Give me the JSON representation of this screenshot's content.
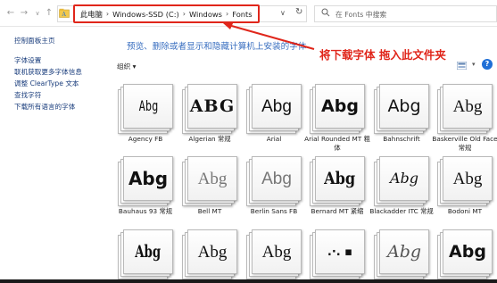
{
  "breadcrumb": [
    "此电脑",
    "Windows-SSD (C:)",
    "Windows",
    "Fonts"
  ],
  "search": {
    "placeholder": "在 Fonts 中搜索"
  },
  "left_pane": [
    "控制面板主页",
    "字体设置",
    "联机获取更多字体信息",
    "调整 ClearType 文本",
    "查找字符",
    "下载所有语言的字体"
  ],
  "description": "预览、删除或者显示和隐藏计算机上安装的字体",
  "annotation": "将下载字体 拖入此文件夹",
  "toolbar": {
    "organize": "组织 ▾",
    "view_dropdown": "▾",
    "help": "?"
  },
  "fonts": [
    {
      "sample": "Abg",
      "name": "Agency FB"
    },
    {
      "sample": "ABG",
      "name": "Algerian 常规"
    },
    {
      "sample": "Abg",
      "name": "Arial"
    },
    {
      "sample": "Abg",
      "name": "Arial Rounded MT 粗体"
    },
    {
      "sample": "Abg",
      "name": "Bahnschrift"
    },
    {
      "sample": "Abg",
      "name": "Baskerville Old Face 常规"
    },
    {
      "sample": "Abg",
      "name": "Bauhaus 93 常规"
    },
    {
      "sample": "Abg",
      "name": "Bell MT"
    },
    {
      "sample": "Abg",
      "name": "Berlin Sans FB"
    },
    {
      "sample": "Abg",
      "name": "Bernard MT 紧缩"
    },
    {
      "sample": "Abg",
      "name": "Blackadder ITC 常规"
    },
    {
      "sample": "Abg",
      "name": "Bodoni MT"
    },
    {
      "sample": "Abg",
      "name": ""
    },
    {
      "sample": "Abg",
      "name": ""
    },
    {
      "sample": "Abg",
      "name": ""
    },
    {
      "sample": ".·. ▪",
      "name": ""
    },
    {
      "sample": "Abg",
      "name": ""
    },
    {
      "sample": "Abg",
      "name": ""
    }
  ],
  "colors": {
    "accent_red": "#e0261b",
    "link_blue": "#3a6fc0"
  }
}
